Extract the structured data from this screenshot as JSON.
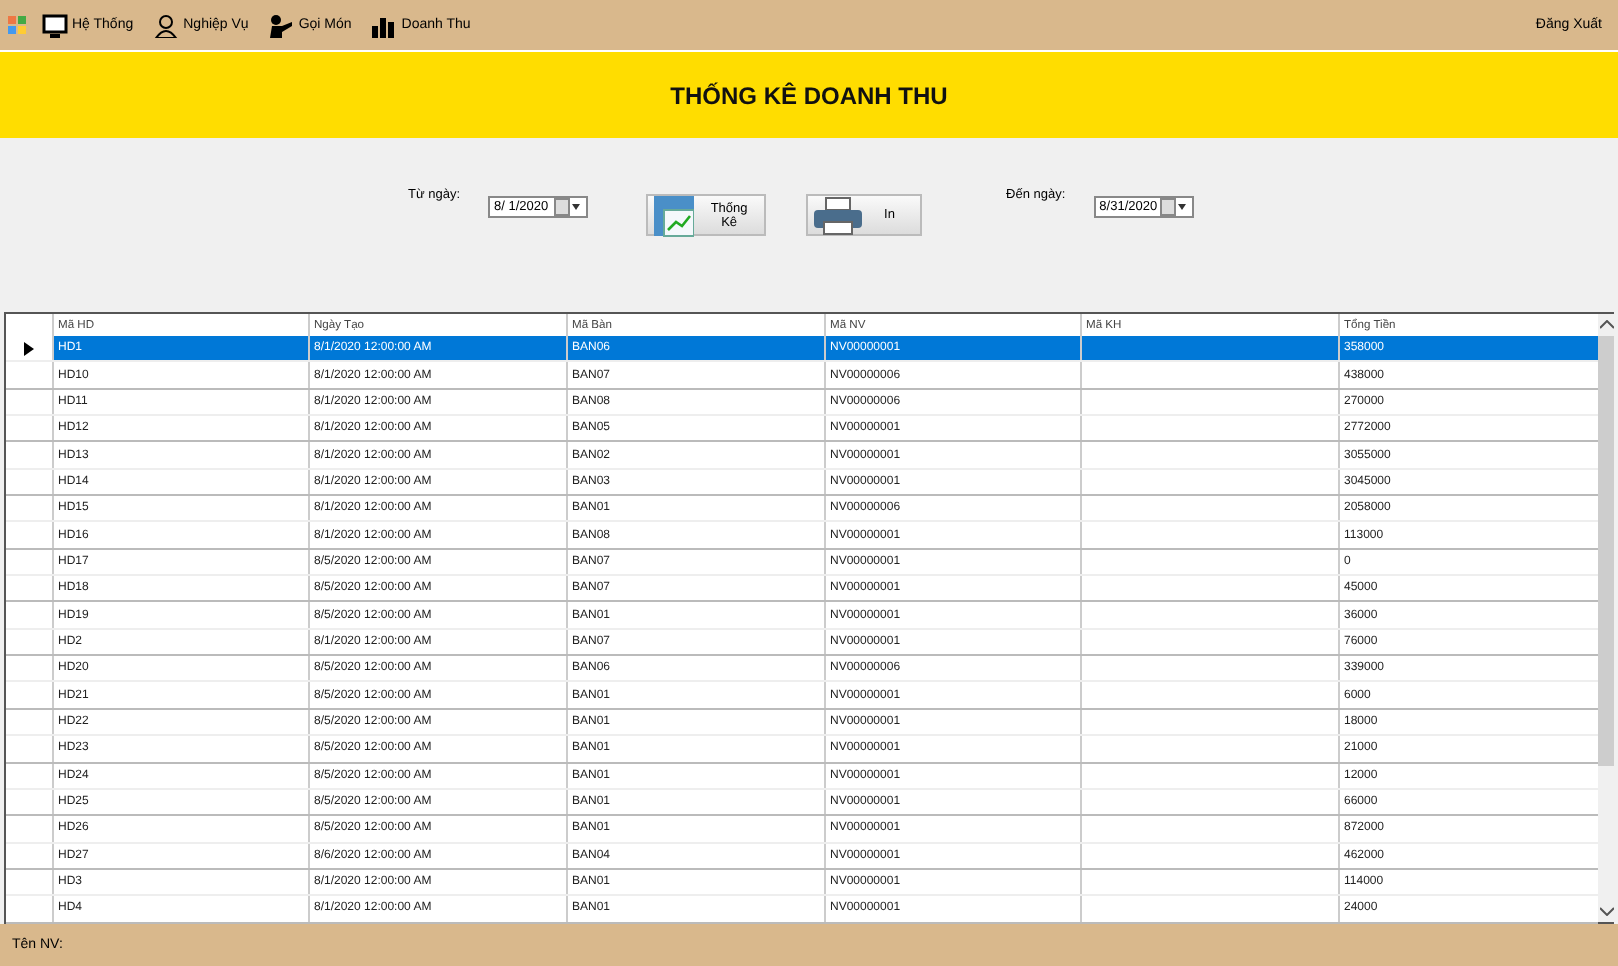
{
  "menu": [
    {
      "kind": "system",
      "label": "Hệ Thống"
    },
    {
      "kind": "user",
      "label": "Nghiệp Vụ"
    },
    {
      "kind": "waiter",
      "label": "Gọi Món"
    },
    {
      "kind": "chart",
      "label": "Doanh Thu"
    }
  ],
  "logout": {
    "label": "Đăng Xuất"
  },
  "header": {
    "title": "THỐNG KÊ DOANH THU"
  },
  "filters": {
    "from_label": "Từ ngày:",
    "from_value": "8/ 1/2020",
    "to_label": "Đến ngày:",
    "to_value": "8/31/2020"
  },
  "buttons": [
    {
      "kind": "stats",
      "label": "Thống Kê"
    },
    {
      "kind": "print",
      "label": "In"
    }
  ],
  "table": {
    "columns": [
      "Mã HD",
      "Ngày Tạo",
      "Mã Bàn",
      "Mã NV",
      "Mã KH",
      "Tổng Tiền"
    ],
    "rows": [
      {
        "selected": true,
        "cells": [
          "HD1",
          "8/1/2020 12:00:00 AM",
          "BAN06",
          "NV00000001",
          "",
          "358000"
        ]
      },
      {
        "selected": false,
        "cells": [
          "HD10",
          "8/1/2020 12:00:00 AM",
          "BAN07",
          "NV00000006",
          "",
          "438000"
        ]
      },
      {
        "selected": false,
        "cells": [
          "HD11",
          "8/1/2020 12:00:00 AM",
          "BAN08",
          "NV00000006",
          "",
          "270000"
        ]
      },
      {
        "selected": false,
        "cells": [
          "HD12",
          "8/1/2020 12:00:00 AM",
          "BAN05",
          "NV00000001",
          "",
          "2772000"
        ]
      },
      {
        "selected": false,
        "cells": [
          "HD13",
          "8/1/2020 12:00:00 AM",
          "BAN02",
          "NV00000001",
          "",
          "3055000"
        ]
      },
      {
        "selected": false,
        "cells": [
          "HD14",
          "8/1/2020 12:00:00 AM",
          "BAN03",
          "NV00000001",
          "",
          "3045000"
        ]
      },
      {
        "selected": false,
        "cells": [
          "HD15",
          "8/1/2020 12:00:00 AM",
          "BAN01",
          "NV00000006",
          "",
          "2058000"
        ]
      },
      {
        "selected": false,
        "cells": [
          "HD16",
          "8/1/2020 12:00:00 AM",
          "BAN08",
          "NV00000001",
          "",
          "113000"
        ]
      },
      {
        "selected": false,
        "cells": [
          "HD17",
          "8/5/2020 12:00:00 AM",
          "BAN07",
          "NV00000001",
          "",
          "0"
        ]
      },
      {
        "selected": false,
        "cells": [
          "HD18",
          "8/5/2020 12:00:00 AM",
          "BAN07",
          "NV00000001",
          "",
          "45000"
        ]
      },
      {
        "selected": false,
        "cells": [
          "HD19",
          "8/5/2020 12:00:00 AM",
          "BAN01",
          "NV00000001",
          "",
          "36000"
        ]
      },
      {
        "selected": false,
        "cells": [
          "HD2",
          "8/1/2020 12:00:00 AM",
          "BAN07",
          "NV00000001",
          "",
          "76000"
        ]
      },
      {
        "selected": false,
        "cells": [
          "HD20",
          "8/5/2020 12:00:00 AM",
          "BAN06",
          "NV00000006",
          "",
          "339000"
        ]
      },
      {
        "selected": false,
        "cells": [
          "HD21",
          "8/5/2020 12:00:00 AM",
          "BAN01",
          "NV00000001",
          "",
          "6000"
        ]
      },
      {
        "selected": false,
        "cells": [
          "HD22",
          "8/5/2020 12:00:00 AM",
          "BAN01",
          "NV00000001",
          "",
          "18000"
        ]
      },
      {
        "selected": false,
        "cells": [
          "HD23",
          "8/5/2020 12:00:00 AM",
          "BAN01",
          "NV00000001",
          "",
          "21000"
        ]
      },
      {
        "selected": false,
        "cells": [
          "HD24",
          "8/5/2020 12:00:00 AM",
          "BAN01",
          "NV00000001",
          "",
          "12000"
        ]
      },
      {
        "selected": false,
        "cells": [
          "HD25",
          "8/5/2020 12:00:00 AM",
          "BAN01",
          "NV00000001",
          "",
          "66000"
        ]
      },
      {
        "selected": false,
        "cells": [
          "HD26",
          "8/5/2020 12:00:00 AM",
          "BAN01",
          "NV00000001",
          "",
          "872000"
        ]
      },
      {
        "selected": false,
        "cells": [
          "HD27",
          "8/6/2020 12:00:00 AM",
          "BAN04",
          "NV00000001",
          "",
          "462000"
        ]
      },
      {
        "selected": false,
        "cells": [
          "HD3",
          "8/1/2020 12:00:00 AM",
          "BAN01",
          "NV00000001",
          "",
          "114000"
        ]
      },
      {
        "selected": false,
        "cells": [
          "HD4",
          "8/1/2020 12:00:00 AM",
          "BAN01",
          "NV00000001",
          "",
          "24000"
        ]
      }
    ]
  },
  "status_bar": {
    "label": "Tên NV:"
  }
}
